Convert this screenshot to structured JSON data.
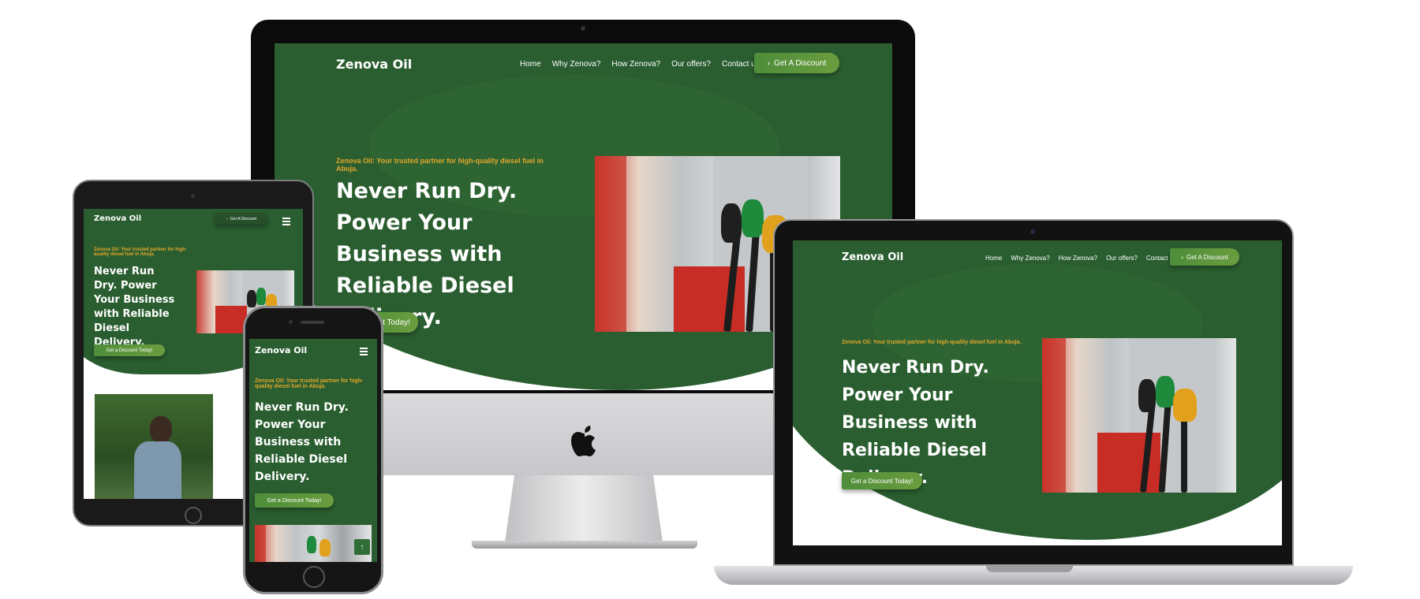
{
  "site": {
    "brand": "Zenova Oil",
    "nav": [
      "Home",
      "Why Zenova?",
      "How Zenova?",
      "Our offers?",
      "Contact us"
    ],
    "header_cta": "Get A Discount",
    "header_cta_mobile": "Get A Discount",
    "tagline": "Zenova Oil: Your trusted partner for high-quality diesel fuel in Abuja.",
    "headline": "Never Run Dry. Power Your Business with Reliable Diesel Delivery.",
    "hero_cta": "Get a Discount Today!",
    "hero_cta_partial": "count Today!",
    "cta_chevron": "›",
    "back_to_top": "↑"
  },
  "colors": {
    "brand_green": "#2a5e30",
    "accent_green": "#5a943c",
    "tagline_orange": "#e3a72b"
  },
  "icons": [
    "apple-logo-icon",
    "hamburger-icon",
    "chevron-right-icon",
    "arrow-up-icon"
  ]
}
